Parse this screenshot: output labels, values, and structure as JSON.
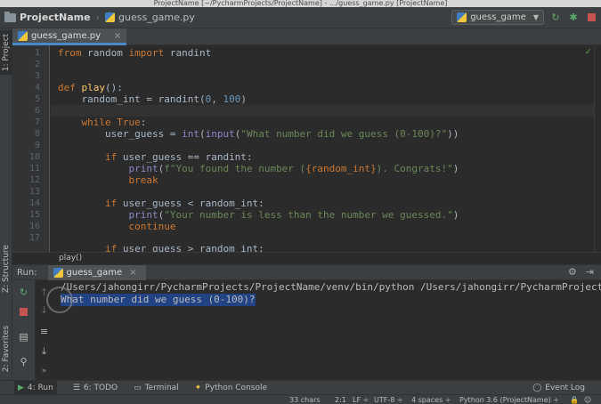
{
  "window": {
    "title": "ProjectName [~/PycharmProjects/ProjectName] - .../guess_game.py [ProjectName]"
  },
  "navbar": {
    "project": "ProjectName",
    "file": "guess_game.py",
    "run_config": "guess_game"
  },
  "left_tabs": {
    "project": "1: Project",
    "structure": "Z: Structure",
    "favorites": "2: Favorites"
  },
  "editor": {
    "tab_label": "guess_game.py",
    "line_numbers": [
      "1",
      "2",
      "3",
      "4",
      "5",
      "6",
      "7",
      "8",
      "9",
      "10",
      "11",
      "12",
      "13",
      "14",
      "15",
      "16",
      "17"
    ],
    "breadcrumb": "play()"
  },
  "code": {
    "l1": {
      "kw1": "from",
      "mod": " random ",
      "kw2": "import",
      "name": " randint"
    },
    "l4": {
      "kw": "def ",
      "fn": "play",
      "rest": "():"
    },
    "l5": {
      "pre": "    random_int = randint(",
      "a": "0",
      "sep": ", ",
      "b": "100",
      "post": ")"
    },
    "l7": {
      "pre": "    ",
      "kw": "while True",
      "post": ":"
    },
    "l8": {
      "pre": "        user_guess = ",
      "bi1": "int",
      "p1": "(",
      "bi2": "input",
      "p2": "(",
      "str": "\"What number did we guess (0-100)?\"",
      "post": "))"
    },
    "l10": {
      "pre": "        ",
      "kw": "if",
      "post": " user_guess == randint:"
    },
    "l11": {
      "pre": "            ",
      "bi": "print",
      "p": "(",
      "s1": "f\"You found the number (",
      "v": "{random_int}",
      "s2": "). Congrats!\"",
      "post": ")"
    },
    "l12": {
      "pre": "            ",
      "kw": "break"
    },
    "l14": {
      "pre": "        ",
      "kw": "if",
      "post": " user_guess < random_int:"
    },
    "l15": {
      "pre": "            ",
      "bi": "print",
      "p": "(",
      "str": "\"Your number is less than the number we guessed.\"",
      "post": ")"
    },
    "l16": {
      "pre": "            ",
      "kw": "continue"
    },
    "l17": {
      "pre": "        ",
      "kw": "if",
      "post": " user_guess > random_int:"
    }
  },
  "run": {
    "label": "Run:",
    "tab": "guess_game",
    "console": [
      "/Users/jahongirr/PycharmProjects/ProjectName/venv/bin/python /Users/jahongirr/PycharmProjects",
      "What number did we guess (0-100)?"
    ]
  },
  "bottom_tools": {
    "run": "4: Run",
    "todo": "6: TODO",
    "terminal": "Terminal",
    "python_console": "Python Console",
    "event_log": "Event Log"
  },
  "status": {
    "chars": "33 chars",
    "pos": "2:1",
    "line_sep": "LF ÷",
    "encoding": "UTF-8 ÷",
    "indent": "4 spaces ÷",
    "interpreter": "Python 3.6 (ProjectName) ÷"
  },
  "colors": {
    "accent": "#4a88c7",
    "selection": "#214283",
    "keyword": "#cc7832",
    "string": "#6a8759",
    "number": "#6897bb",
    "function": "#ffc66d"
  }
}
